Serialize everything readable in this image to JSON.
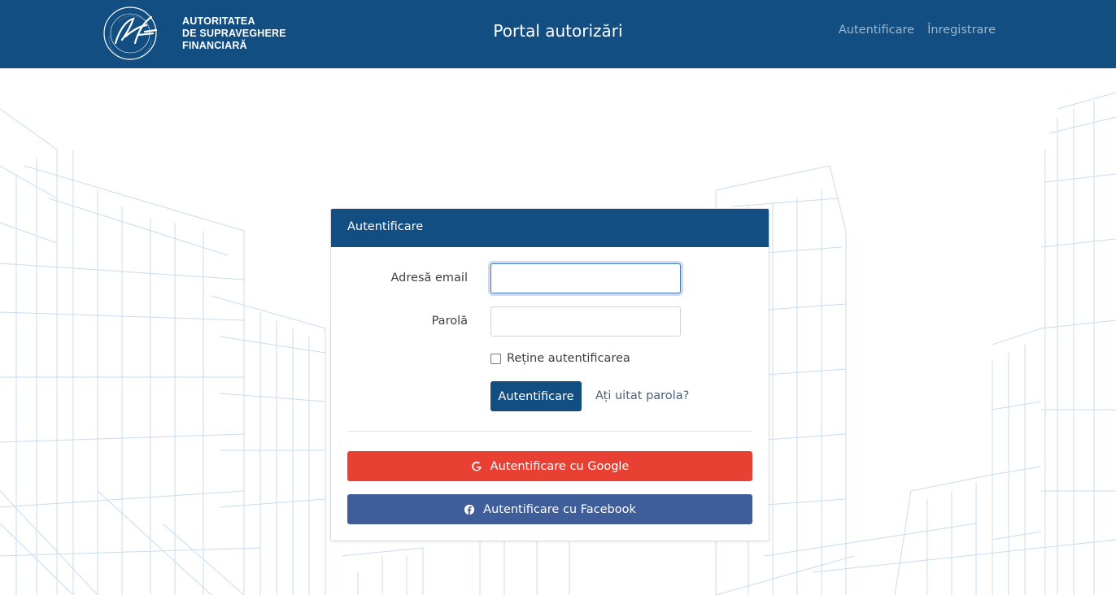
{
  "header": {
    "logo_text_lines": [
      "AUTORITATEA",
      "DE SUPRAVEGHERE",
      "FINANCIARĂ"
    ],
    "logo_seal_text": "ROMÂNIA AUTORITATEA DE SUPRAVEGHERE FINANCIARĂ",
    "title": "Portal autorizări",
    "nav": {
      "login": "Autentificare",
      "register": "Înregistrare"
    }
  },
  "login_card": {
    "title": "Autentificare",
    "email_label": "Adresă email",
    "email_value": "",
    "password_label": "Parolă",
    "password_value": "",
    "remember_label": "Reține autentificarea",
    "remember_checked": false,
    "submit_label": "Autentificare",
    "forgot_label": "Ați uitat parola?",
    "google_label": "Autentificare cu Google",
    "facebook_label": "Autentificare cu Facebook"
  },
  "icons": {
    "google": "google-g-icon",
    "facebook": "facebook-icon"
  },
  "colors": {
    "primary": "#124e82",
    "google": "#e84134",
    "facebook": "#3f5d99",
    "nav_link": "#9db7cf",
    "background_lines": "#c9dcef"
  }
}
